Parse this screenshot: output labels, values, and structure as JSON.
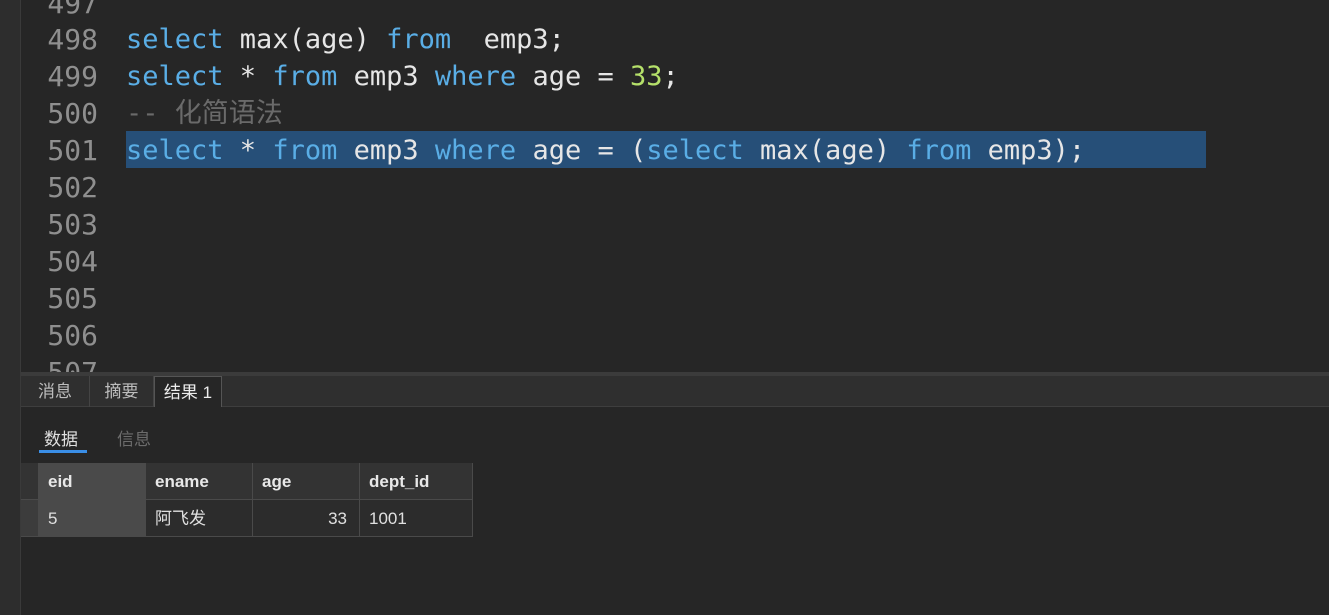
{
  "editor": {
    "line_numbers": [
      "497",
      "498",
      "499",
      "500",
      "501",
      "502",
      "503",
      "504",
      "505",
      "506",
      "507"
    ],
    "lines": [
      {
        "t1": "select",
        "t2": " max(age) ",
        "t3": "from",
        "t4": "  emp3;"
      },
      {
        "t1": "select",
        "t2": " * ",
        "t3": "from",
        "t4": " emp3 ",
        "t5": "where",
        "t6": " age = ",
        "t7": "33",
        "t8": ";"
      },
      {
        "comment": "-- 化简语法"
      },
      {
        "t1": "select",
        "t2": " * ",
        "t3": "from",
        "t4": " emp3 ",
        "t5": "where",
        "t6": " age = (",
        "t7": "select",
        "t8": " max(age) ",
        "t9": "from",
        "t10": " emp3);"
      }
    ]
  },
  "result_tabs": {
    "messages": "消息",
    "summary": "摘要",
    "result1": "结果 1"
  },
  "sub_tabs": {
    "data": "数据",
    "info": "信息"
  },
  "grid": {
    "columns": [
      "eid",
      "ename",
      "age",
      "dept_id"
    ],
    "rows": [
      [
        "5",
        "阿飞发",
        "33",
        "1001"
      ]
    ]
  },
  "colors": {
    "keyword": "#5aaee6",
    "number": "#b5e06a",
    "selection": "#264f78",
    "accent": "#3a8ee6"
  }
}
